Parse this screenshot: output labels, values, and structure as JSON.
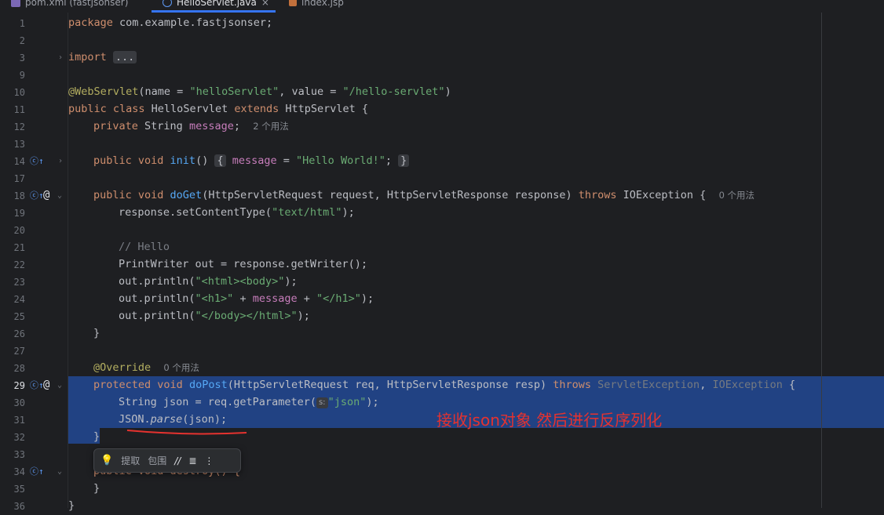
{
  "tabs": [
    {
      "label": "pom.xml (fastjsonser)",
      "icon": "maven-icon",
      "active": false
    },
    {
      "label": "HelloServlet.java",
      "icon": "class-icon",
      "active": true
    },
    {
      "label": "index.jsp",
      "icon": "jsp-icon",
      "active": false
    }
  ],
  "code": {
    "line1": {
      "num": "1",
      "kw": "package",
      "rest": " com.example.fastjsonser;"
    },
    "line2": {
      "num": "2"
    },
    "line3": {
      "num": "3",
      "kw": "import",
      "fold": "..."
    },
    "line9": {
      "num": "9"
    },
    "line10": {
      "num": "10",
      "ann": "@WebServlet",
      "p1": "(name = ",
      "s1": "\"helloServlet\"",
      "p2": ", value = ",
      "s2": "\"/hello-servlet\"",
      "p3": ")"
    },
    "line11": {
      "num": "11",
      "kw": "public class",
      "name": " HelloServlet ",
      "kw2": "extends",
      "rest": " HttpServlet {"
    },
    "line12": {
      "num": "12",
      "kw": "private",
      "type": " String ",
      "fld": "message",
      "semi": ";",
      "hint": "2 个用法"
    },
    "line13": {
      "num": "13"
    },
    "line14": {
      "num": "14",
      "kw": "public void",
      "fn": "init",
      "paren": "()",
      "lb": "{",
      "fld": "message",
      "eq": " = ",
      "str": "\"Hello World!\"",
      "semi": ";",
      "rb": "}"
    },
    "line17": {
      "num": "17"
    },
    "line18": {
      "num": "18",
      "kw": "public void",
      "fn": "doGet",
      "p1": "(HttpServletRequest request, HttpServletResponse response) ",
      "kw2": "throws",
      "p2": " IOException {",
      "hint": "0 个用法"
    },
    "line19": {
      "num": "19",
      "p1": "response.setContentType(",
      "str": "\"text/html\"",
      "p2": ");"
    },
    "line20": {
      "num": "20"
    },
    "line21": {
      "num": "21",
      "cmt": "// Hello"
    },
    "line22": {
      "num": "22",
      "p1": "PrintWriter out = response.getWriter();"
    },
    "line23": {
      "num": "23",
      "p1": "out.println(",
      "str": "\"<html><body>\"",
      "p2": ");"
    },
    "line24": {
      "num": "24",
      "p1": "out.println(",
      "s1": "\"<h1>\"",
      "p2": " + ",
      "fld": "message",
      "p3": " + ",
      "s2": "\"</h1>\"",
      "p4": ");"
    },
    "line25": {
      "num": "25",
      "p1": "out.println(",
      "str": "\"</body></html>\"",
      "p2": ");"
    },
    "line26": {
      "num": "26",
      "p1": "}"
    },
    "line27": {
      "num": "27"
    },
    "line28": {
      "num": "28",
      "ann": "@Override",
      "hint": "0 个用法"
    },
    "line29": {
      "num": "29",
      "kw": "protected void",
      "fn": "doPost",
      "p1": "(HttpServletRequest req, HttpServletResponse resp) ",
      "kw2": "throws",
      "d1": " ServletException",
      "p2": ", ",
      "d2": "IOException",
      "p3": " {"
    },
    "line30": {
      "num": "30",
      "p1": "String json = req.getParameter(",
      "phint": "s:",
      "str": "\"json\"",
      "p2": ");"
    },
    "line31": {
      "num": "31",
      "p1": "JSON.",
      "it": "parse",
      "p2": "(json);"
    },
    "line32": {
      "num": "32",
      "p1": "}"
    },
    "line33": {
      "num": "33"
    },
    "line34": {
      "num": "34",
      "p1": "public void destroy() {"
    },
    "line35": {
      "num": "35",
      "p1": "}"
    },
    "line36": {
      "num": "36",
      "p1": "}"
    }
  },
  "annotation_text": "接收json对象 然后进行反序列化",
  "toolbar": {
    "extract_label": "提取",
    "wrap_label": "包围",
    "comment_glyph": "//",
    "format_glyph": "≣",
    "more_glyph": "⋮"
  },
  "colors": {
    "keyword": "#cf8e6d",
    "string": "#6aab73",
    "annotation": "#b3ae60",
    "field": "#c77dbb",
    "method": "#56a8f5",
    "selection": "#214283",
    "annotation_red": "#e5322f"
  }
}
